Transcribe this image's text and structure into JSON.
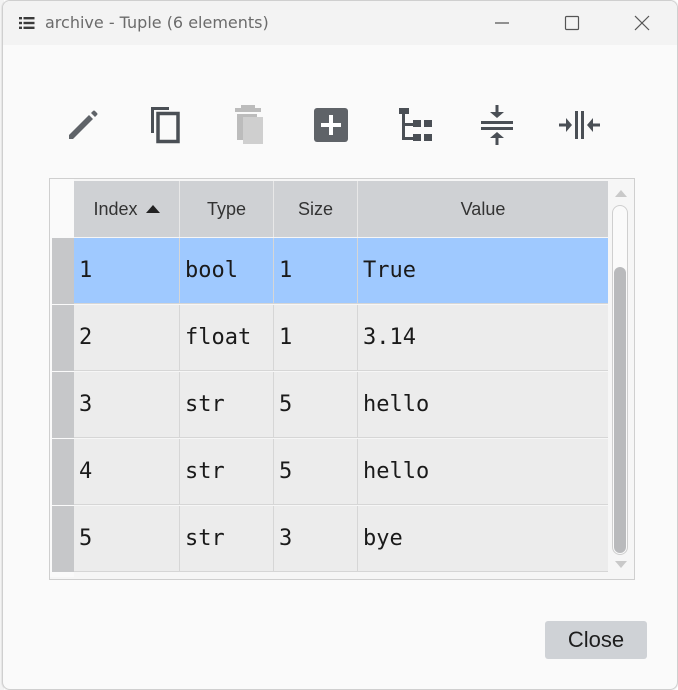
{
  "window": {
    "title": "archive - Tuple (6 elements)",
    "app_icon": "list-icon",
    "controls": [
      "minimize-icon",
      "maximize-icon",
      "close-icon"
    ]
  },
  "toolbar": {
    "buttons": [
      {
        "name": "edit",
        "icon": "pencil-icon",
        "enabled": true
      },
      {
        "name": "copy",
        "icon": "copy-icon",
        "enabled": true
      },
      {
        "name": "remove",
        "icon": "trash-icon",
        "enabled": false
      },
      {
        "name": "insert",
        "icon": "plus-square-icon",
        "enabled": true
      },
      {
        "name": "tree",
        "icon": "tree-view-icon",
        "enabled": true
      },
      {
        "name": "collapse",
        "icon": "collapse-vertical-icon",
        "enabled": true
      },
      {
        "name": "expand",
        "icon": "collapse-horizontal-icon",
        "enabled": true
      }
    ]
  },
  "table": {
    "columns": [
      "Index",
      "Type",
      "Size",
      "Value"
    ],
    "sort_column": "Index",
    "sort_direction": "ascending",
    "rows": [
      {
        "index": "1",
        "type": "bool",
        "size": "1",
        "value": "True",
        "selected": true
      },
      {
        "index": "2",
        "type": "float",
        "size": "1",
        "value": "3.14",
        "selected": false
      },
      {
        "index": "3",
        "type": "str",
        "size": "5",
        "value": "hello",
        "selected": false
      },
      {
        "index": "4",
        "type": "str",
        "size": "5",
        "value": "hello",
        "selected": false
      },
      {
        "index": "5",
        "type": "str",
        "size": "3",
        "value": "bye",
        "selected": false
      }
    ]
  },
  "footer": {
    "close_label": "Close"
  },
  "colors": {
    "selection": "#9fc9ff",
    "header": "#cfd1d4",
    "cell": "#ececec",
    "button": "#cfd2d6"
  }
}
